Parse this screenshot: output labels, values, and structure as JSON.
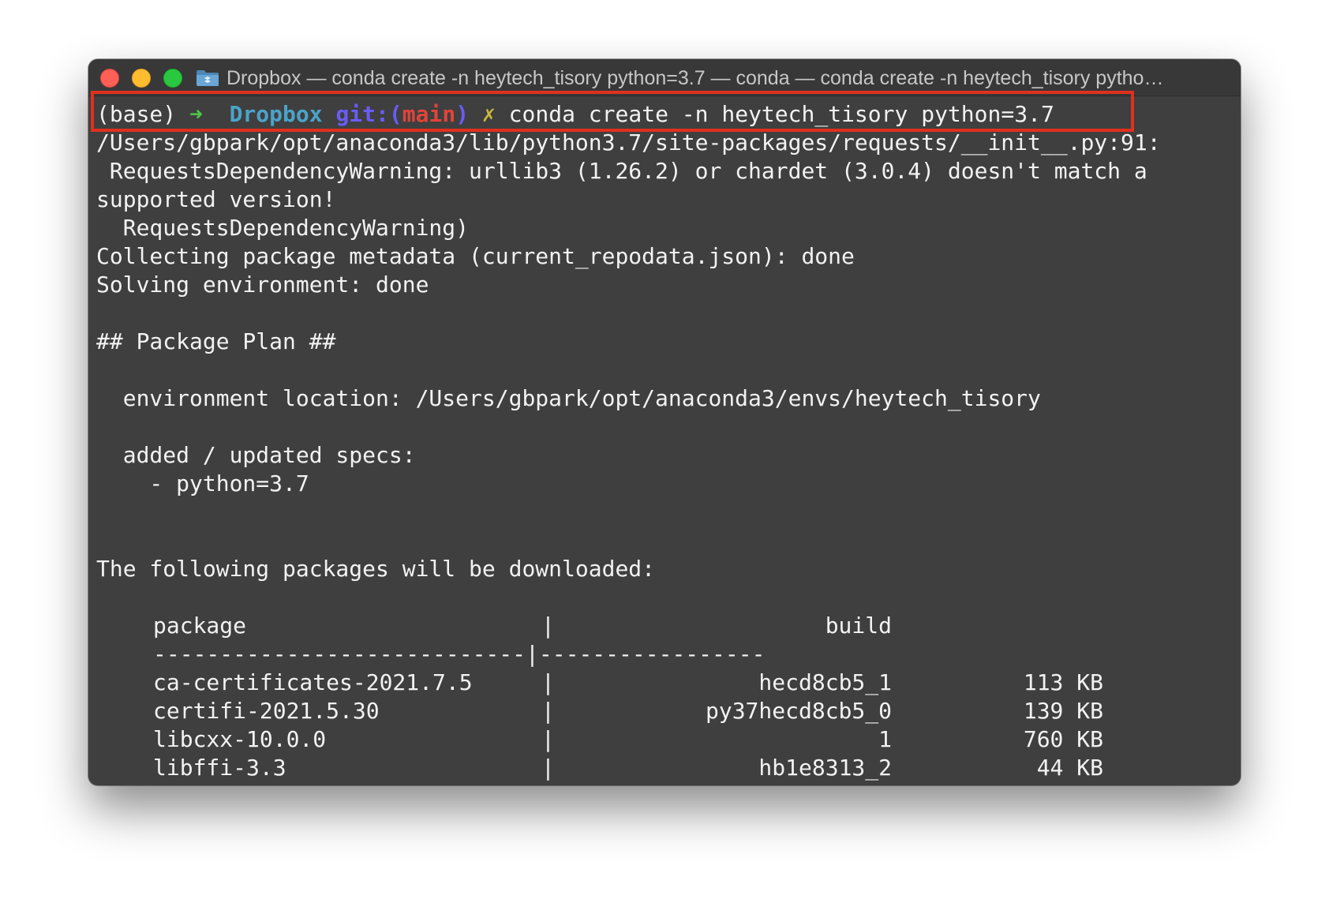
{
  "window": {
    "title": "Dropbox — conda create -n heytech_tisory python=3.7 — conda — conda create -n heytech_tisory pytho…"
  },
  "prompt": {
    "env": "(base)",
    "arrow": "➜",
    "dir": "Dropbox",
    "git_prefix": "git:(",
    "branch": "main",
    "git_suffix": ")",
    "dirty_mark": "✗",
    "command": "conda create -n heytech_tisory python=3.7"
  },
  "output": {
    "lines": [
      "/Users/gbpark/opt/anaconda3/lib/python3.7/site-packages/requests/__init__.py:91:",
      " RequestsDependencyWarning: urllib3 (1.26.2) or chardet (3.0.4) doesn't match a",
      "supported version!",
      "  RequestsDependencyWarning)",
      "Collecting package metadata (current_repodata.json): done",
      "Solving environment: done",
      "",
      "## Package Plan ##",
      "",
      "  environment location: /Users/gbpark/opt/anaconda3/envs/heytech_tisory",
      "",
      "  added / updated specs:",
      "    - python=3.7",
      "",
      "",
      "The following packages will be downloaded:"
    ]
  },
  "package_table": {
    "headers": {
      "package": "package",
      "sep": "|",
      "build": "build"
    },
    "divider": "----------------------------|-----------------",
    "rows": [
      {
        "package": "ca-certificates-2021.7.5",
        "build": "hecd8cb5_1",
        "size": "113 KB"
      },
      {
        "package": "certifi-2021.5.30",
        "build": "py37hecd8cb5_0",
        "size": "139 KB"
      },
      {
        "package": "libcxx-10.0.0",
        "build": "1",
        "size": "760 KB"
      },
      {
        "package": "libffi-3.3",
        "build": "hb1e8313_2",
        "size": "44 KB"
      }
    ]
  },
  "colors": {
    "terminal_bg": "#3f3f3f",
    "text": "#f2f2f2",
    "highlight_box": "#e0301e",
    "prompt_arrow": "#4ec745",
    "prompt_dir": "#4aa3c9",
    "prompt_git": "#6a5cf5",
    "prompt_branch": "#e0443a",
    "prompt_dirty": "#c9b83c"
  }
}
